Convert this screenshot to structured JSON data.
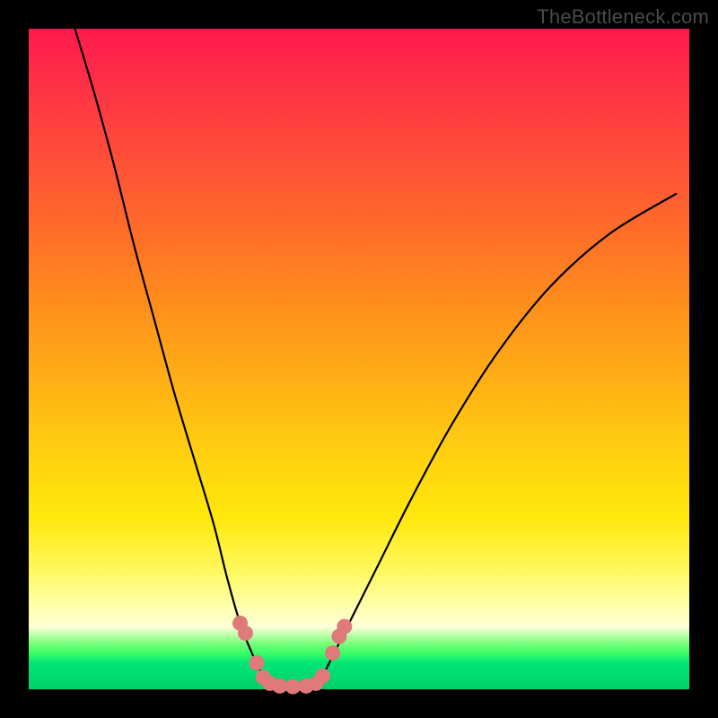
{
  "watermark": "TheBottleneck.com",
  "chart_data": {
    "type": "line",
    "title": "",
    "xlabel": "",
    "ylabel": "",
    "xlim": [
      0,
      100
    ],
    "ylim": [
      0,
      100
    ],
    "grid": false,
    "legend": false,
    "series": [
      {
        "name": "left-branch",
        "x": [
          7,
          10,
          13,
          16,
          19,
          22,
          25,
          28,
          30,
          32,
          34,
          36
        ],
        "values": [
          100,
          90,
          79,
          67,
          56,
          45,
          35,
          25,
          17,
          10,
          5,
          1
        ]
      },
      {
        "name": "right-branch",
        "x": [
          44,
          46,
          49,
          53,
          58,
          64,
          71,
          79,
          88,
          98
        ],
        "values": [
          1,
          5,
          11,
          19,
          29,
          40,
          51,
          61,
          69,
          75
        ]
      },
      {
        "name": "bottom-segment",
        "x": [
          36,
          38,
          40,
          42,
          44
        ],
        "values": [
          1,
          0.5,
          0.4,
          0.5,
          1
        ]
      }
    ],
    "markers": {
      "name": "highlight-dots",
      "color": "#e07a7a",
      "points": [
        {
          "x": 32.0,
          "y": 10.0
        },
        {
          "x": 32.8,
          "y": 8.5
        },
        {
          "x": 34.5,
          "y": 4.0
        },
        {
          "x": 35.5,
          "y": 1.8
        },
        {
          "x": 36.5,
          "y": 0.9
        },
        {
          "x": 38.0,
          "y": 0.5
        },
        {
          "x": 40.0,
          "y": 0.4
        },
        {
          "x": 42.0,
          "y": 0.5
        },
        {
          "x": 43.5,
          "y": 0.9
        },
        {
          "x": 44.5,
          "y": 2.0
        },
        {
          "x": 46.0,
          "y": 5.5
        },
        {
          "x": 47.0,
          "y": 8.0
        },
        {
          "x": 47.8,
          "y": 9.5
        }
      ]
    },
    "gradient_stops": [
      {
        "pos": 0.0,
        "color": "#ff1a4d"
      },
      {
        "pos": 0.35,
        "color": "#ff7a22"
      },
      {
        "pos": 0.74,
        "color": "#ffe80c"
      },
      {
        "pos": 0.9,
        "color": "#ffffd6"
      },
      {
        "pos": 0.94,
        "color": "#3cff66"
      },
      {
        "pos": 1.0,
        "color": "#00d068"
      }
    ]
  }
}
